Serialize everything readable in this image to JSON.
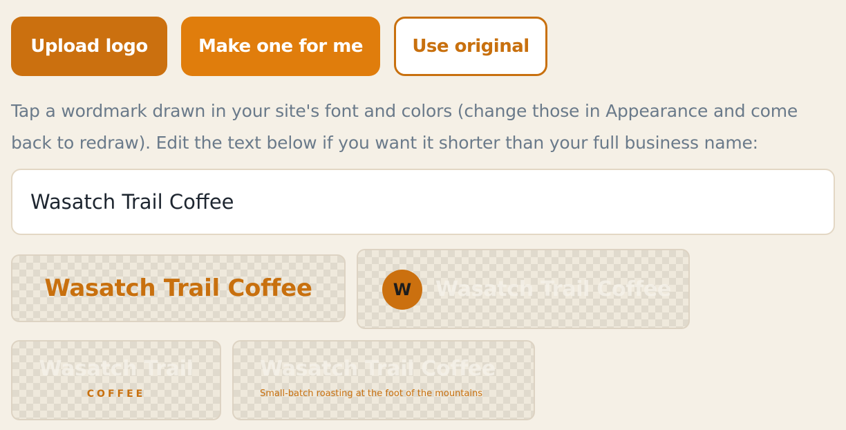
{
  "buttons": {
    "upload_logo": "Upload logo",
    "make_one": "Make one for me",
    "use_original": "Use original"
  },
  "help_text": "Tap a wordmark drawn in your site's font and colors (change those in Appearance and come back to redraw). Edit the text below if you want it shorter than your full business name:",
  "name_input": {
    "value": "Wasatch Trail Coffee"
  },
  "wordmarks": {
    "option_1": {
      "text": "Wasatch Trail Coffee"
    },
    "option_2": {
      "monogram": "W",
      "text": "Wasatch Trail Coffee"
    },
    "option_3": {
      "top": "Wasatch Trail",
      "bottom": "COFFEE"
    },
    "option_4": {
      "text": "Wasatch Trail Coffee",
      "tagline": "Small-batch roasting at the foot of the mountains"
    }
  },
  "colors": {
    "accent": "#c8700e",
    "accent_bright": "#e07d0c",
    "background": "#f5f0e6",
    "help_text": "#6a7a8a"
  },
  "icons": {
    "transparency": "checkerboard-pattern"
  }
}
